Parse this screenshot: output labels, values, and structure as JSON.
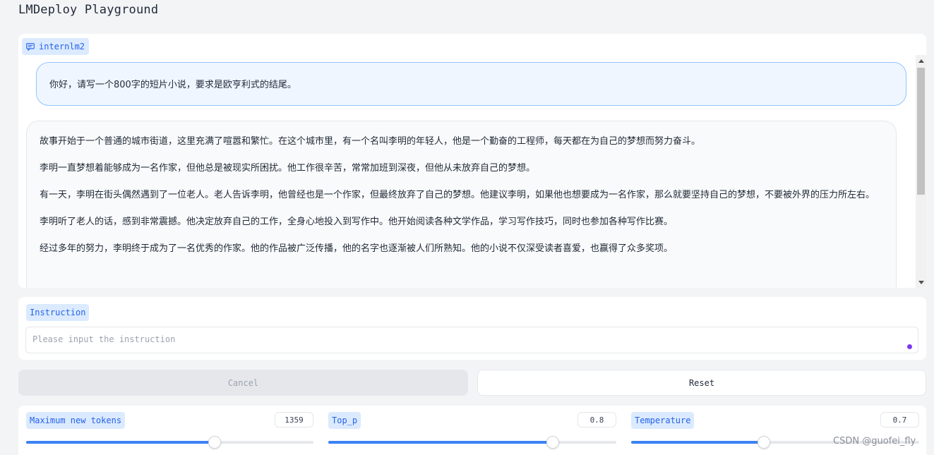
{
  "app": {
    "title": "LMDeploy Playground"
  },
  "chat": {
    "model_label": "internlm2",
    "model_icon": "chat-bubble-icon",
    "user_message": "你好，请写一个800字的短片小说，要求是欧亨利式的结尾。",
    "bot_paragraphs": [
      "故事开始于一个普通的城市街道，这里充满了喧嚣和繁忙。在这个城市里，有一个名叫李明的年轻人，他是一个勤奋的工程师，每天都在为自己的梦想而努力奋斗。",
      "李明一直梦想着能够成为一名作家，但他总是被现实所困扰。他工作很辛苦，常常加班到深夜，但他从未放弃自己的梦想。",
      "有一天，李明在街头偶然遇到了一位老人。老人告诉李明，他曾经也是一个作家，但最终放弃了自己的梦想。他建议李明，如果他也想要成为一名作家，那么就要坚持自己的梦想，不要被外界的压力所左右。",
      "李明听了老人的话，感到非常震撼。他决定放弃自己的工作，全身心地投入到写作中。他开始阅读各种文学作品，学习写作技巧，同时也参加各种写作比赛。",
      "经过多年的努力，李明终于成为了一名优秀的作家。他的作品被广泛传播，他的名字也逐渐被人们所熟知。他的小说不仅深受读者喜爱，也赢得了众多奖项。"
    ]
  },
  "instruction": {
    "label": "Instruction",
    "placeholder": "Please input the instruction",
    "value": ""
  },
  "buttons": {
    "cancel": "Cancel",
    "reset": "Reset"
  },
  "sliders": [
    {
      "label": "Maximum new tokens",
      "value": "1359",
      "fraction": 0.655
    },
    {
      "label": "Top_p",
      "value": "0.8",
      "fraction": 0.78
    },
    {
      "label": "Temperature",
      "value": "0.7",
      "fraction": 0.46
    }
  ],
  "watermark": "CSDN @guofei_fly",
  "colors": {
    "accent": "#3b82f6",
    "chip_bg": "#dbeafe",
    "chip_text": "#2563eb"
  }
}
